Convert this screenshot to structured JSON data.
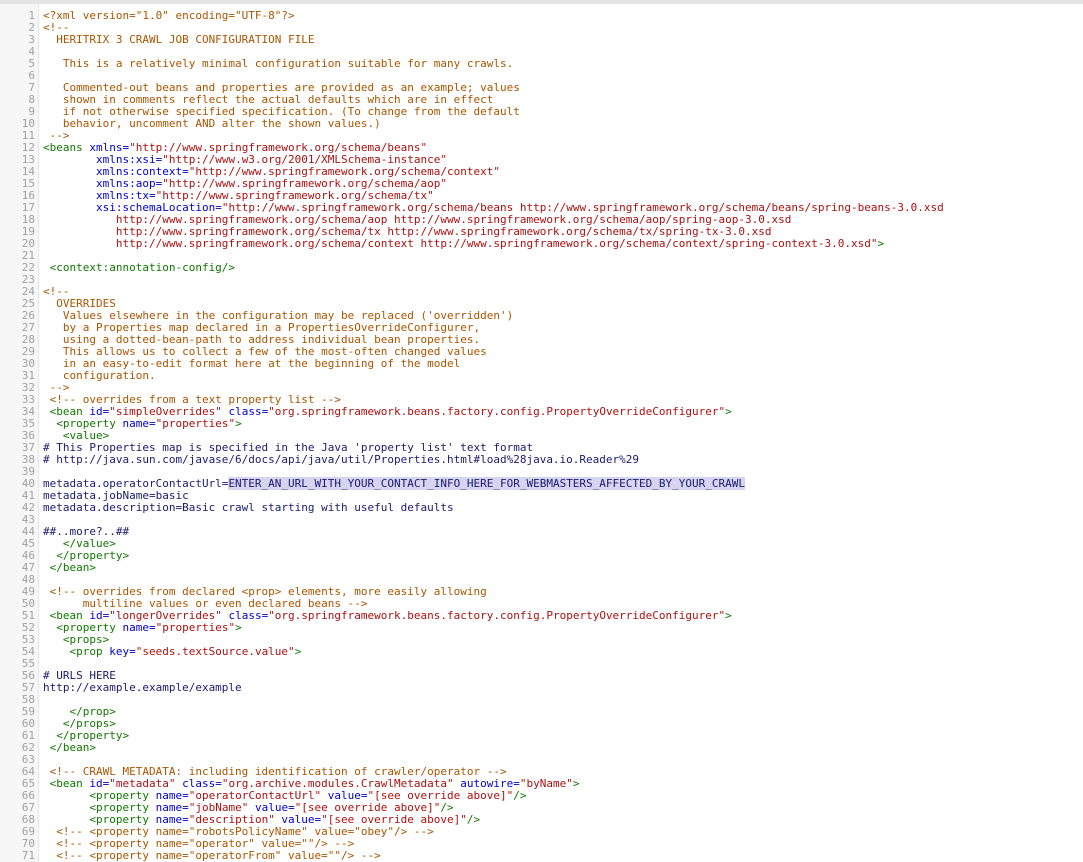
{
  "editor": {
    "lines": [
      {
        "n": "1",
        "t": [
          [
            "c",
            "<?xml version=\"1.0\" encoding=\"UTF-8\"?>"
          ]
        ]
      },
      {
        "n": "2",
        "t": [
          [
            "c",
            "<!--"
          ]
        ]
      },
      {
        "n": "3",
        "t": [
          [
            "c",
            "  HERITRIX 3 CRAWL JOB CONFIGURATION FILE"
          ]
        ]
      },
      {
        "n": "4",
        "t": [
          [
            "c",
            "  "
          ]
        ]
      },
      {
        "n": "5",
        "t": [
          [
            "c",
            "   This is a relatively minimal configuration suitable for many crawls."
          ]
        ]
      },
      {
        "n": "6",
        "t": [
          [
            "c",
            "   "
          ]
        ]
      },
      {
        "n": "7",
        "t": [
          [
            "c",
            "   Commented-out beans and properties are provided as an example; values"
          ]
        ]
      },
      {
        "n": "8",
        "t": [
          [
            "c",
            "   shown in comments reflect the actual defaults which are in effect"
          ]
        ]
      },
      {
        "n": "9",
        "t": [
          [
            "c",
            "   if not otherwise specified specification. (To change from the default "
          ]
        ]
      },
      {
        "n": "10",
        "t": [
          [
            "c",
            "   behavior, uncomment AND alter the shown values.)   "
          ]
        ]
      },
      {
        "n": "11",
        "t": [
          [
            "c",
            " -->"
          ]
        ]
      },
      {
        "n": "12",
        "t": [
          [
            "tg",
            "<beans "
          ],
          [
            "at",
            "xmlns="
          ],
          [
            "st",
            "\"http://www.springframework.org/schema/beans\""
          ]
        ]
      },
      {
        "n": "13",
        "t": [
          [
            "pl",
            "        "
          ],
          [
            "at",
            "xmlns:xsi="
          ],
          [
            "st",
            "\"http://www.w3.org/2001/XMLSchema-instance\""
          ]
        ]
      },
      {
        "n": "14",
        "t": [
          [
            "pl",
            "        "
          ],
          [
            "at",
            "xmlns:context="
          ],
          [
            "st",
            "\"http://www.springframework.org/schema/context\""
          ]
        ]
      },
      {
        "n": "15",
        "t": [
          [
            "pl",
            "        "
          ],
          [
            "at",
            "xmlns:aop="
          ],
          [
            "st",
            "\"http://www.springframework.org/schema/aop\""
          ]
        ]
      },
      {
        "n": "16",
        "t": [
          [
            "pl",
            "        "
          ],
          [
            "at",
            "xmlns:tx="
          ],
          [
            "st",
            "\"http://www.springframework.org/schema/tx\""
          ]
        ]
      },
      {
        "n": "17",
        "t": [
          [
            "pl",
            "        "
          ],
          [
            "at",
            "xsi:schemaLocation="
          ],
          [
            "st",
            "\"http://www.springframework.org/schema/beans http://www.springframework.org/schema/beans/spring-beans-3.0.xsd"
          ]
        ]
      },
      {
        "n": "18",
        "t": [
          [
            "st",
            "           http://www.springframework.org/schema/aop http://www.springframework.org/schema/aop/spring-aop-3.0.xsd"
          ]
        ]
      },
      {
        "n": "19",
        "t": [
          [
            "st",
            "           http://www.springframework.org/schema/tx http://www.springframework.org/schema/tx/spring-tx-3.0.xsd"
          ]
        ]
      },
      {
        "n": "20",
        "t": [
          [
            "st",
            "           http://www.springframework.org/schema/context http://www.springframework.org/schema/context/spring-context-3.0.xsd\""
          ],
          [
            "tg",
            ">"
          ]
        ]
      },
      {
        "n": "21",
        "t": [
          [
            "pl",
            " "
          ]
        ]
      },
      {
        "n": "22",
        "t": [
          [
            "tg",
            " <context:annotation-config/>"
          ]
        ]
      },
      {
        "n": "23",
        "t": [
          [
            "pl",
            " "
          ]
        ]
      },
      {
        "n": "24",
        "t": [
          [
            "c",
            "<!-- "
          ]
        ]
      },
      {
        "n": "25",
        "t": [
          [
            "c",
            "  OVERRIDES"
          ]
        ]
      },
      {
        "n": "26",
        "t": [
          [
            "c",
            "   Values elsewhere in the configuration may be replaced ('overridden') "
          ]
        ]
      },
      {
        "n": "27",
        "t": [
          [
            "c",
            "   by a Properties map declared in a PropertiesOverrideConfigurer, "
          ]
        ]
      },
      {
        "n": "28",
        "t": [
          [
            "c",
            "   using a dotted-bean-path to address individual bean properties. "
          ]
        ]
      },
      {
        "n": "29",
        "t": [
          [
            "c",
            "   This allows us to collect a few of the most-often changed values"
          ]
        ]
      },
      {
        "n": "30",
        "t": [
          [
            "c",
            "   in an easy-to-edit format here at the beginning of the model"
          ]
        ]
      },
      {
        "n": "31",
        "t": [
          [
            "c",
            "   configuration.    "
          ]
        ]
      },
      {
        "n": "32",
        "t": [
          [
            "c",
            " -->"
          ]
        ]
      },
      {
        "n": "33",
        "t": [
          [
            "c",
            " <!-- overrides from a text property list -->"
          ]
        ]
      },
      {
        "n": "34",
        "t": [
          [
            "tg",
            " <bean "
          ],
          [
            "at",
            "id="
          ],
          [
            "st",
            "\"simpleOverrides\""
          ],
          [
            "at",
            " class="
          ],
          [
            "st",
            "\"org.springframework.beans.factory.config.PropertyOverrideConfigurer\""
          ],
          [
            "tg",
            ">"
          ]
        ]
      },
      {
        "n": "35",
        "t": [
          [
            "tg",
            "  <property "
          ],
          [
            "at",
            "name="
          ],
          [
            "st",
            "\"properties\""
          ],
          [
            "tg",
            ">"
          ]
        ]
      },
      {
        "n": "36",
        "t": [
          [
            "tg",
            "   <value>"
          ]
        ]
      },
      {
        "n": "37",
        "t": [
          [
            "pl",
            "# This Properties map is specified in the Java 'property list' text format"
          ]
        ]
      },
      {
        "n": "38",
        "t": [
          [
            "pl",
            "# http://java.sun.com/javase/6/docs/api/java/util/Properties.html#load%28java.io.Reader%29"
          ]
        ]
      },
      {
        "n": "39",
        "t": [
          [
            "pl",
            " "
          ]
        ]
      },
      {
        "n": "40",
        "t": [
          [
            "pl",
            "metadata.operatorContactUrl="
          ],
          [
            "hl",
            "ENTER_AN_URL_WITH_YOUR_CONTACT_INFO_HERE_FOR_WEBMASTERS_AFFECTED_BY_YOUR_CRAWL"
          ]
        ]
      },
      {
        "n": "41",
        "t": [
          [
            "pl",
            "metadata.jobName=basic"
          ]
        ]
      },
      {
        "n": "42",
        "t": [
          [
            "pl",
            "metadata.description=Basic crawl starting with useful defaults"
          ]
        ]
      },
      {
        "n": "43",
        "t": [
          [
            "pl",
            " "
          ]
        ]
      },
      {
        "n": "44",
        "t": [
          [
            "pl",
            "##..more?..##"
          ]
        ]
      },
      {
        "n": "45",
        "t": [
          [
            "tg",
            "   </value>"
          ]
        ]
      },
      {
        "n": "46",
        "t": [
          [
            "tg",
            "  </property>"
          ]
        ]
      },
      {
        "n": "47",
        "t": [
          [
            "tg",
            " </bean>"
          ]
        ]
      },
      {
        "n": "48",
        "t": [
          [
            "pl",
            " "
          ]
        ]
      },
      {
        "n": "49",
        "t": [
          [
            "c",
            " <!-- overrides from declared <prop> elements, more easily allowing"
          ]
        ]
      },
      {
        "n": "50",
        "t": [
          [
            "c",
            "      multiline values or even declared beans -->"
          ]
        ]
      },
      {
        "n": "51",
        "t": [
          [
            "tg",
            " <bean "
          ],
          [
            "at",
            "id="
          ],
          [
            "st",
            "\"longerOverrides\""
          ],
          [
            "at",
            " class="
          ],
          [
            "st",
            "\"org.springframework.beans.factory.config.PropertyOverrideConfigurer\""
          ],
          [
            "tg",
            ">"
          ]
        ]
      },
      {
        "n": "52",
        "t": [
          [
            "tg",
            "  <property "
          ],
          [
            "at",
            "name="
          ],
          [
            "st",
            "\"properties\""
          ],
          [
            "tg",
            ">"
          ]
        ]
      },
      {
        "n": "53",
        "t": [
          [
            "tg",
            "   <props>"
          ]
        ]
      },
      {
        "n": "54",
        "t": [
          [
            "tg",
            "    <prop "
          ],
          [
            "at",
            "key="
          ],
          [
            "st",
            "\"seeds.textSource.value\""
          ],
          [
            "tg",
            ">"
          ]
        ]
      },
      {
        "n": "55",
        "t": [
          [
            "pl",
            " "
          ]
        ]
      },
      {
        "n": "56",
        "t": [
          [
            "pl",
            "# URLS HERE"
          ]
        ]
      },
      {
        "n": "57",
        "t": [
          [
            "pl",
            "http://example.example/example"
          ]
        ]
      },
      {
        "n": "58",
        "t": [
          [
            "pl",
            " "
          ]
        ]
      },
      {
        "n": "59",
        "t": [
          [
            "tg",
            "    </prop>"
          ]
        ]
      },
      {
        "n": "60",
        "t": [
          [
            "tg",
            "   </props>"
          ]
        ]
      },
      {
        "n": "61",
        "t": [
          [
            "tg",
            "  </property>"
          ]
        ]
      },
      {
        "n": "62",
        "t": [
          [
            "tg",
            " </bean>"
          ]
        ]
      },
      {
        "n": "63",
        "t": [
          [
            "pl",
            " "
          ]
        ]
      },
      {
        "n": "64",
        "t": [
          [
            "c",
            " <!-- CRAWL METADATA: including identification of crawler/operator -->"
          ]
        ]
      },
      {
        "n": "65",
        "t": [
          [
            "tg",
            " <bean "
          ],
          [
            "at",
            "id="
          ],
          [
            "st",
            "\"metadata\""
          ],
          [
            "at",
            " class="
          ],
          [
            "st",
            "\"org.archive.modules.CrawlMetadata\""
          ],
          [
            "at",
            " autowire="
          ],
          [
            "st",
            "\"byName\""
          ],
          [
            "tg",
            ">"
          ]
        ]
      },
      {
        "n": "66",
        "t": [
          [
            "tg",
            "       <property "
          ],
          [
            "at",
            "name="
          ],
          [
            "st",
            "\"operatorContactUrl\""
          ],
          [
            "at",
            " value="
          ],
          [
            "st",
            "\"[see override above]\""
          ],
          [
            "tg",
            "/>"
          ]
        ]
      },
      {
        "n": "67",
        "t": [
          [
            "tg",
            "       <property "
          ],
          [
            "at",
            "name="
          ],
          [
            "st",
            "\"jobName\""
          ],
          [
            "at",
            " value="
          ],
          [
            "st",
            "\"[see override above]\""
          ],
          [
            "tg",
            "/>"
          ]
        ]
      },
      {
        "n": "68",
        "t": [
          [
            "tg",
            "       <property "
          ],
          [
            "at",
            "name="
          ],
          [
            "st",
            "\"description\""
          ],
          [
            "at",
            " value="
          ],
          [
            "st",
            "\"[see override above]\""
          ],
          [
            "tg",
            "/>"
          ]
        ]
      },
      {
        "n": "69",
        "t": [
          [
            "c",
            "  <!-- <property name=\"robotsPolicyName\" value=\"obey\"/> -->"
          ]
        ]
      },
      {
        "n": "70",
        "t": [
          [
            "c",
            "  <!-- <property name=\"operator\" value=\"\"/> -->"
          ]
        ]
      },
      {
        "n": "71",
        "t": [
          [
            "c",
            "  <!-- <property name=\"operatorFrom\" value=\"\"/> -->"
          ]
        ]
      }
    ]
  }
}
